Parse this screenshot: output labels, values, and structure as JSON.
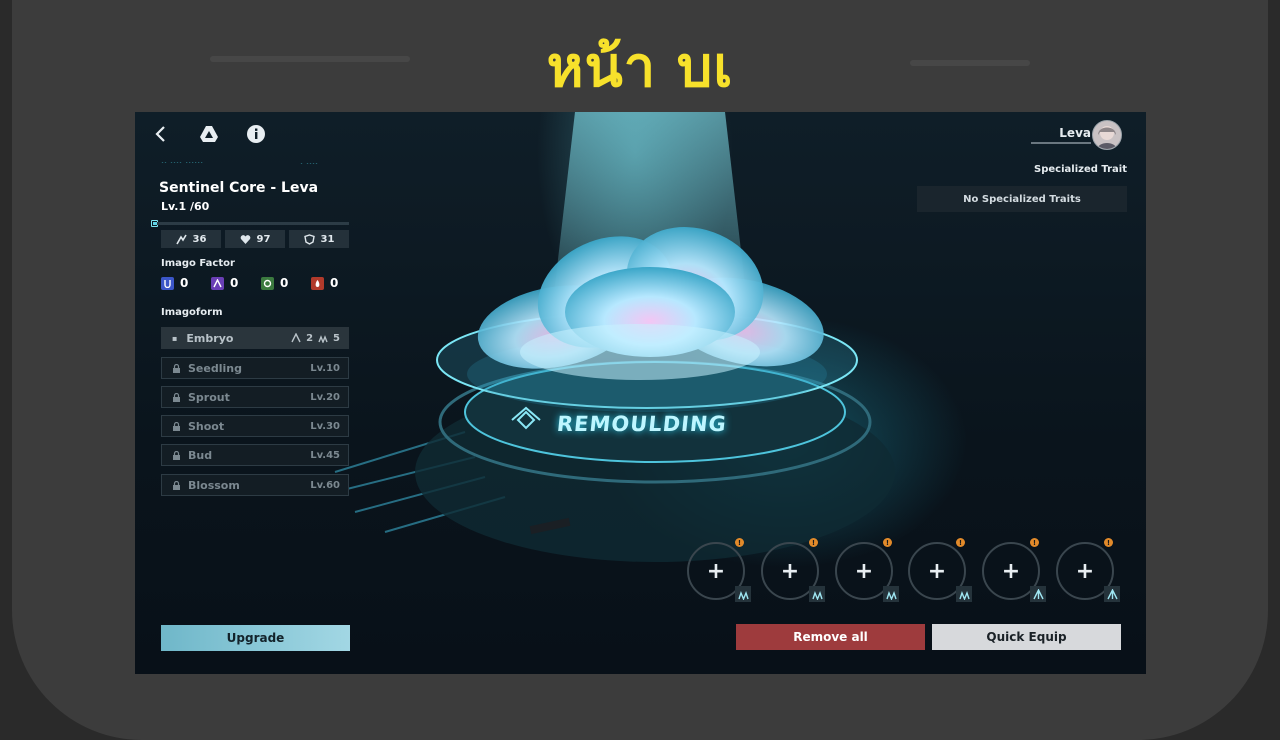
{
  "page": {
    "title": "หน้า บเ"
  },
  "topbar": {
    "back_icon": "chevron-left-icon",
    "drive_icon": "triangle-logo-icon",
    "info_icon": "info-icon",
    "player_name": "Leva"
  },
  "core": {
    "name": "Sentinel Core - Leva",
    "level": "Lv.1 /60",
    "level_progress": 0.0,
    "stats": [
      {
        "icon": "attack-icon",
        "value": "36"
      },
      {
        "icon": "heart-icon",
        "value": "97"
      },
      {
        "icon": "shield-icon",
        "value": "31"
      }
    ]
  },
  "imago_factor": {
    "label": "Imago Factor",
    "items": [
      {
        "icon": "u-factor-icon",
        "color": "#3b56c8",
        "value": "0"
      },
      {
        "icon": "a-factor-icon",
        "color": "#6a3fb5",
        "value": "0"
      },
      {
        "icon": "ring-factor-icon",
        "color": "#3b7a3f",
        "value": "0"
      },
      {
        "icon": "flame-factor-icon",
        "color": "#b13a2b",
        "value": "0"
      }
    ]
  },
  "imagoform": {
    "label": "Imagoform",
    "stages": [
      {
        "name": "Embryo",
        "active": true,
        "stat1": "2",
        "stat2": "5"
      },
      {
        "name": "Seedling",
        "level": "Lv.10"
      },
      {
        "name": "Sprout",
        "level": "Lv.20"
      },
      {
        "name": "Shoot",
        "level": "Lv.30"
      },
      {
        "name": "Bud",
        "level": "Lv.45"
      },
      {
        "name": "Blossom",
        "level": "Lv.60"
      }
    ]
  },
  "specialized": {
    "label": "Specialized Trait",
    "value": "No Specialized Traits"
  },
  "center": {
    "platform_text": "REMOULDING"
  },
  "slots": {
    "plus": "+",
    "warn": "!",
    "types": [
      "wave-type-icon",
      "wave-type-icon",
      "wave-type-icon",
      "wave-type-icon",
      "spike-type-icon",
      "spike-type-icon"
    ]
  },
  "buttons": {
    "upgrade": "Upgrade",
    "remove_all": "Remove all",
    "quick_equip": "Quick Equip"
  }
}
